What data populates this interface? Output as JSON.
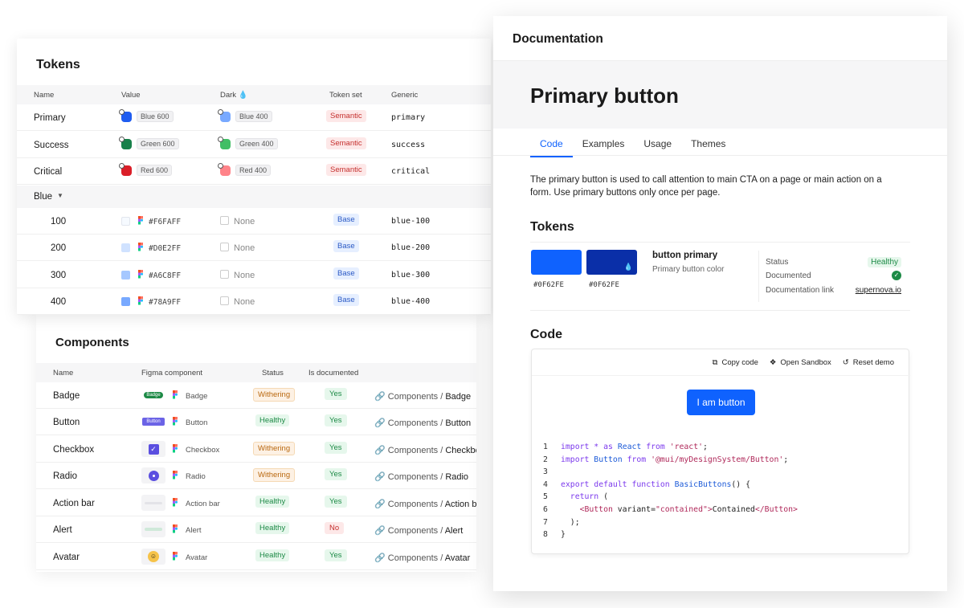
{
  "tokens": {
    "title": "Tokens",
    "columns": [
      "Name",
      "Value",
      "Dark",
      "Token set",
      "Generic"
    ],
    "semantic_rows": [
      {
        "name": "Primary",
        "value": "Blue 600",
        "dark": "Blue 400",
        "token_set": "Semantic",
        "generic": "primary",
        "color": "#1f5cf0",
        "dark_color": "#78a9ff"
      },
      {
        "name": "Success",
        "value": "Green 600",
        "dark": "Green 400",
        "token_set": "Semantic",
        "generic": "success",
        "color": "#18804a",
        "dark_color": "#42be65"
      },
      {
        "name": "Critical",
        "value": "Red 600",
        "dark": "Red 400",
        "token_set": "Semantic",
        "generic": "critical",
        "color": "#da1e28",
        "dark_color": "#ff8389"
      }
    ],
    "group": {
      "label": "Blue"
    },
    "base_rows": [
      {
        "name": "100",
        "hex": "#F6FAFF",
        "dark": "None",
        "token_set": "Base",
        "generic": "blue-100",
        "color": "#F6FAFF"
      },
      {
        "name": "200",
        "hex": "#D0E2FF",
        "dark": "None",
        "token_set": "Base",
        "generic": "blue-200",
        "color": "#D0E2FF"
      },
      {
        "name": "300",
        "hex": "#A6C8FF",
        "dark": "None",
        "token_set": "Base",
        "generic": "blue-300",
        "color": "#A6C8FF"
      },
      {
        "name": "400",
        "hex": "#78A9FF",
        "dark": "None",
        "token_set": "Base",
        "generic": "blue-400",
        "color": "#78A9FF"
      }
    ]
  },
  "components": {
    "title": "Components",
    "columns": [
      "Name",
      "Figma component",
      "Status",
      "Is documented"
    ],
    "rows": [
      {
        "name": "Badge",
        "figma": "Badge",
        "status": "Withering",
        "documented": "Yes",
        "path_prefix": "Components / ",
        "path_last": "Badge",
        "thumb_label": "Badge"
      },
      {
        "name": "Button",
        "figma": "Button",
        "status": "Healthy",
        "documented": "Yes",
        "path_prefix": "Components / ",
        "path_last": "Button",
        "thumb_label": "Button"
      },
      {
        "name": "Checkbox",
        "figma": "Checkbox",
        "status": "Withering",
        "documented": "Yes",
        "path_prefix": "Components / ",
        "path_last": "Checkbox",
        "thumb_label": ""
      },
      {
        "name": "Radio",
        "figma": "Radio",
        "status": "Withering",
        "documented": "Yes",
        "path_prefix": "Components / ",
        "path_last": "Radio",
        "thumb_label": ""
      },
      {
        "name": "Action bar",
        "figma": "Action bar",
        "status": "Healthy",
        "documented": "Yes",
        "path_prefix": "Components / ",
        "path_last": "Action bar",
        "thumb_label": ""
      },
      {
        "name": "Alert",
        "figma": "Alert",
        "status": "Healthy",
        "documented": "No",
        "path_prefix": "Components / ",
        "path_last": "Alert",
        "thumb_label": ""
      },
      {
        "name": "Avatar",
        "figma": "Avatar",
        "status": "Healthy",
        "documented": "Yes",
        "path_prefix": "Components / ",
        "path_last": "Avatar",
        "thumb_label": ""
      }
    ]
  },
  "doc": {
    "topbar_title": "Documentation",
    "page_title": "Primary button",
    "tabs": [
      "Code",
      "Examples",
      "Usage",
      "Themes"
    ],
    "active_tab": "Code",
    "description": "The primary button is used to call attention to main CTA on a page or main action on a form. Use primary buttons only once per page.",
    "tokens_heading": "Tokens",
    "token": {
      "light_hex": "#0F62FE",
      "dark_hex": "#0F62FE",
      "light_color": "#0f62fe",
      "dark_color": "#0a2fa8",
      "name": "button primary",
      "description": "Primary button color"
    },
    "meta": {
      "status_label": "Status",
      "status_value": "Healthy",
      "documented_label": "Documented",
      "doc_link_label": "Documentation link",
      "doc_link_value": "supernova.io"
    },
    "code_heading": "Code",
    "toolbar": {
      "copy": "Copy code",
      "sandbox": "Open Sandbox",
      "reset": "Reset demo"
    },
    "demo_button": "I am button",
    "code": [
      {
        "n": "1",
        "parts": [
          [
            "kw",
            "import"
          ],
          [
            "plain",
            " "
          ],
          [
            "kw",
            "*"
          ],
          [
            "plain",
            " "
          ],
          [
            "kw",
            "as"
          ],
          [
            "plain",
            " "
          ],
          [
            "fn",
            "React"
          ],
          [
            "plain",
            " "
          ],
          [
            "kw",
            "from"
          ],
          [
            "plain",
            " "
          ],
          [
            "str",
            "'react'"
          ],
          [
            "plain",
            ";"
          ]
        ]
      },
      {
        "n": "2",
        "parts": [
          [
            "kw",
            "import"
          ],
          [
            "plain",
            " "
          ],
          [
            "fn",
            "Button"
          ],
          [
            "plain",
            " "
          ],
          [
            "kw",
            "from"
          ],
          [
            "plain",
            " "
          ],
          [
            "str",
            "'@mui/myDesignSystem/Button'"
          ],
          [
            "plain",
            ";"
          ]
        ]
      },
      {
        "n": "3",
        "parts": []
      },
      {
        "n": "4",
        "parts": [
          [
            "kw",
            "export"
          ],
          [
            "plain",
            " "
          ],
          [
            "kw",
            "default"
          ],
          [
            "plain",
            " "
          ],
          [
            "kw",
            "function"
          ],
          [
            "plain",
            " "
          ],
          [
            "fn",
            "BasicButtons"
          ],
          [
            "plain",
            "() {"
          ]
        ]
      },
      {
        "n": "5",
        "parts": [
          [
            "plain",
            "  "
          ],
          [
            "kw",
            "return"
          ],
          [
            "plain",
            " ("
          ]
        ]
      },
      {
        "n": "6",
        "parts": [
          [
            "plain",
            "    "
          ],
          [
            "tag",
            "<Button"
          ],
          [
            "plain",
            " variant="
          ],
          [
            "str",
            "\"contained\""
          ],
          [
            "tag",
            ">"
          ],
          [
            "plain",
            "Contained"
          ],
          [
            "tag",
            "</Button>"
          ]
        ]
      },
      {
        "n": "7",
        "parts": [
          [
            "plain",
            "  );"
          ]
        ]
      },
      {
        "n": "8",
        "parts": [
          [
            "plain",
            "}"
          ]
        ]
      }
    ]
  }
}
